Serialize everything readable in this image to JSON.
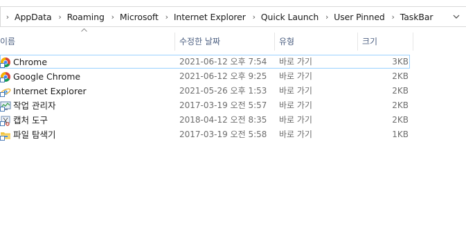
{
  "breadcrumb": {
    "items": [
      {
        "label": "AppData"
      },
      {
        "label": "Roaming"
      },
      {
        "label": "Microsoft"
      },
      {
        "label": "Internet Explorer"
      },
      {
        "label": "Quick Launch"
      },
      {
        "label": "User Pinned"
      },
      {
        "label": "TaskBar"
      }
    ],
    "separator": "›"
  },
  "columns": {
    "name": "이름",
    "date": "수정한 날짜",
    "type": "유형",
    "size": "크기"
  },
  "files": [
    {
      "name": "Chrome",
      "date": "2021-06-12 오후 7:54",
      "type": "바로 가기",
      "size": "3KB",
      "icon": "chrome-icon",
      "selected": true
    },
    {
      "name": "Google Chrome",
      "date": "2021-06-12 오후 9:25",
      "type": "바로 가기",
      "size": "2KB",
      "icon": "chrome-icon",
      "selected": false
    },
    {
      "name": "Internet Explorer",
      "date": "2021-05-26 오후 1:53",
      "type": "바로 가기",
      "size": "2KB",
      "icon": "internet-explorer-icon",
      "selected": false
    },
    {
      "name": "작업 관리자",
      "date": "2017-03-19 오전 5:57",
      "type": "바로 가기",
      "size": "2KB",
      "icon": "task-manager-icon",
      "selected": false
    },
    {
      "name": "캡처 도구",
      "date": "2018-04-12 오전 8:35",
      "type": "바로 가기",
      "size": "2KB",
      "icon": "snipping-tool-icon",
      "selected": false
    },
    {
      "name": "파일 탐색기",
      "date": "2017-03-19 오전 5:58",
      "type": "바로 가기",
      "size": "1KB",
      "icon": "file-explorer-icon",
      "selected": false
    }
  ],
  "colors": {
    "header_text": "#4d6082",
    "selection_border": "#99d1ff",
    "secondary_text": "#6d6d6d"
  }
}
